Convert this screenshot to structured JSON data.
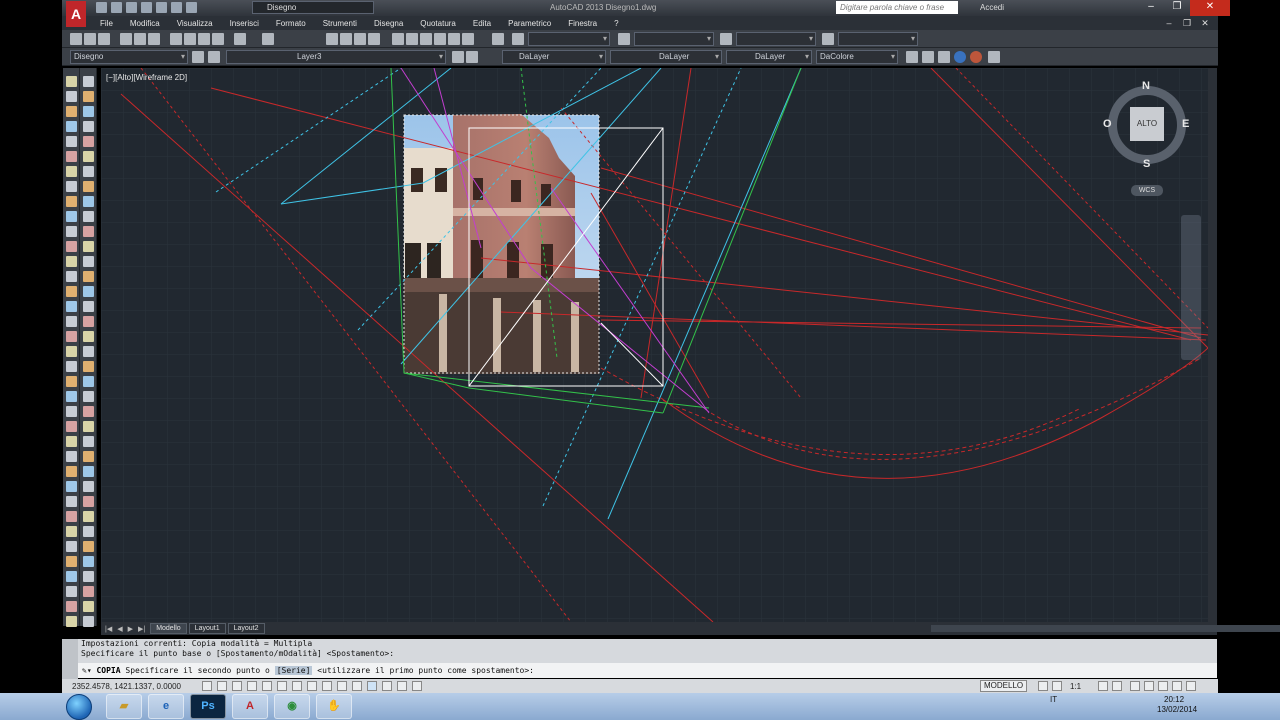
{
  "window": {
    "app_logo": "A",
    "title": "AutoCAD 2013    Disegno1.dwg",
    "workspace": "Disegno",
    "search_placeholder": "Digitare parola chiave o frase",
    "signin": "Accedi",
    "minimize": "–",
    "maximize": "❐",
    "close": "✕"
  },
  "menu": {
    "items": [
      "File",
      "Modifica",
      "Visualizza",
      "Inserisci",
      "Formato",
      "Strumenti",
      "Disegna",
      "Quotatura",
      "Edita",
      "Parametrico",
      "Finestra",
      "?"
    ]
  },
  "toolbar2": {
    "workspace_combo": "Disegno",
    "layer_combo": "Layer3",
    "color_combo": "DaLayer",
    "linetype_combo": "DaLayer",
    "lineweight_combo": "DaLayer",
    "plotstyle_combo": "DaColore"
  },
  "viewport": {
    "label": "[−][Alto][Wireframe 2D]"
  },
  "viewcube": {
    "face": "ALTO",
    "north": "N",
    "south": "S",
    "east": "E",
    "west": "O",
    "ucs": "WCS"
  },
  "tabs": {
    "items": [
      "Modello",
      "Layout1",
      "Layout2"
    ],
    "active": "Modello"
  },
  "command": {
    "history_line1": "Impostazioni correnti:  Copia modalità = Multipla",
    "history_line2": "Specificare il punto base o [Spostamento/mOdalità] <Spostamento>:",
    "prompt_name": "COPIA",
    "prompt_text": "Specificare il secondo punto o",
    "prompt_option": "[Serie]",
    "prompt_tail": "<utilizzare il primo punto come spostamento>:"
  },
  "status": {
    "coordinates": "2352.4578, 1421.1337, 0.0000",
    "space": "MODELLO",
    "scale": "1:1"
  },
  "taskbar": {
    "language": "IT",
    "time": "20:12",
    "date": "13/02/2014"
  },
  "colors": {
    "canvas": "#212830",
    "red": "#c8282a",
    "cyan": "#3fc3e6",
    "green": "#33c24a",
    "magenta": "#c23ecf",
    "white": "#ffffff"
  }
}
